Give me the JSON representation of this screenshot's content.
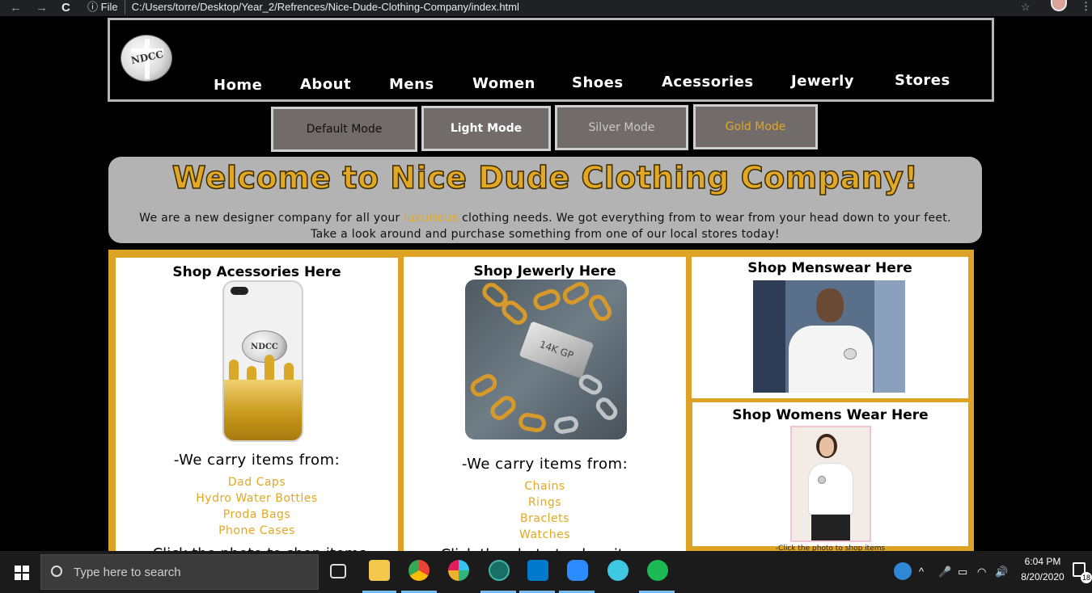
{
  "browser": {
    "back": "←",
    "forward": "→",
    "reload": "C",
    "info_icon": "ⓘ",
    "file_label": "File",
    "url": "C:/Users/torre/Desktop/Year_2/Refrences/Nice-Dude-Clothing-Company/index.html",
    "star": "☆",
    "menu": "⋮"
  },
  "logo": {
    "text": "NDCC"
  },
  "nav": [
    "Home",
    "About",
    "Mens",
    "Women",
    "Shoes",
    "Acessories",
    "Jewerly",
    "Stores"
  ],
  "modes": [
    {
      "label": "Default Mode",
      "color": "#111111"
    },
    {
      "label": "Light Mode",
      "color": "#ffffff"
    },
    {
      "label": "Silver Mode",
      "color": "#c0c0c0"
    },
    {
      "label": "Gold Mode",
      "color": "#e2a823"
    }
  ],
  "welcome": {
    "title": "Welcome to Nice Dude Clothing Company!",
    "text_before": "We are a new designer company for all your ",
    "highlight": "luxurious",
    "text_after": " clothing needs. We got everything from to wear from your head down to your feet. Take a look around and purchase something from one of our local stores today!"
  },
  "accessories": {
    "heading": "Shop Acessories Here",
    "badge": "NDCC",
    "carry": "-We carry items from:",
    "items": [
      "Dad Caps",
      "Hydro Water Bottles",
      "Proda Bags",
      "Phone Cases"
    ],
    "click": "-Click the photo to shop items"
  },
  "jewelry": {
    "heading": "Shop Jewerly Here",
    "clasp": "14K GP",
    "carry": "-We carry items from:",
    "items": [
      "Chains",
      "Rings",
      "Braclets",
      "Watches"
    ],
    "click": "-Click the photo to shop items"
  },
  "menswear": {
    "heading": "Shop Menswear Here"
  },
  "womenswear": {
    "heading": "Shop Womens Wear Here",
    "caption": "-Click the photo to shop items"
  },
  "taskbar": {
    "search_placeholder": "Type here to search",
    "time": "6:04 PM",
    "date": "8/20/2020",
    "notifications": "18"
  },
  "colors": {
    "gold": "#e2a823",
    "panel": "#b3b3b3",
    "button": "#716b69"
  }
}
